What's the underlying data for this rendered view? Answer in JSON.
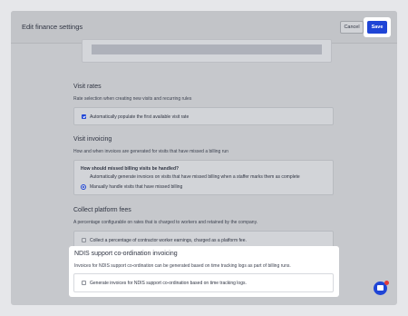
{
  "header": {
    "title": "Edit finance settings",
    "cancel_label": "Cancel",
    "save_label": "Save"
  },
  "sections": {
    "visit_rates": {
      "title": "Visit rates",
      "description": "Rate selection when creating new visits and recurring rules",
      "option_label": "Automatically populate the first available visit rate",
      "option_checked": true
    },
    "visit_invoicing": {
      "title": "Visit invoicing",
      "description": "How and when invoices are generated for visits that have missed a billing run",
      "question": "How should missed billing visits be handled?",
      "options": [
        {
          "label": "Automatically generate invoices on visits that have missed billing when a staffer marks them as complete",
          "selected": false
        },
        {
          "label": "Manually handle visits that have missed billing",
          "selected": true
        }
      ]
    },
    "platform_fees": {
      "title": "Collect platform fees",
      "description": "A percentage configurable on rates that is charged to workers and retained by the company.",
      "option_label": "Collect a percentage of contractor worker earnings, charged as a platform fee.",
      "option_checked": false
    },
    "ndis": {
      "title": "NDIS support co-ordination invoicing",
      "description": "Invoices for NDIS support co-ordination can be generated based on time tracking logs as part of billing runs.",
      "option_label": "Generate invoices for NDIS support co-ordination based on time tracking logs.",
      "option_checked": false
    }
  },
  "chat": {
    "badge_count": "1"
  },
  "colors": {
    "accent": "#1f45d6",
    "badge": "#e23b3b"
  }
}
